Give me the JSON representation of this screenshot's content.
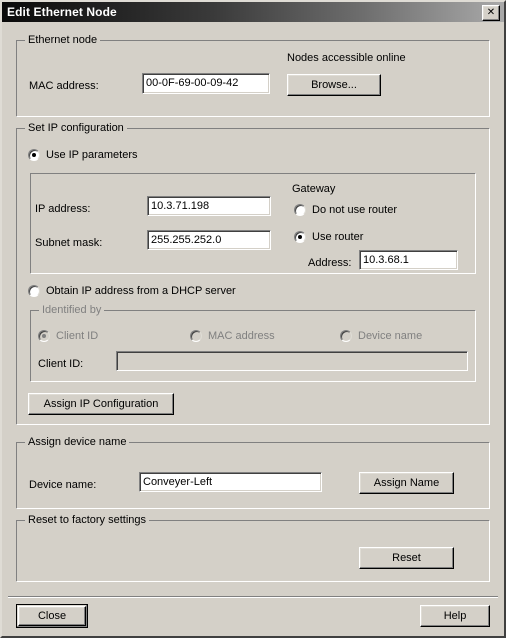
{
  "window": {
    "title": "Edit Ethernet Node",
    "close_icon": "close-icon",
    "close_glyph": "✕"
  },
  "ethernet_node": {
    "group_title": "Ethernet node",
    "nodes_online_label": "Nodes accessible online",
    "mac_label": "MAC address:",
    "mac_value": "00-0F-69-00-09-42",
    "mac_placeholder": "",
    "browse_button": "Browse..."
  },
  "ip_config": {
    "group_title": "Set IP configuration",
    "use_ip_parameters": {
      "label": "Use IP parameters",
      "checked": true
    },
    "ip_address_label": "IP address:",
    "ip_address_value": "10.3.71.198",
    "subnet_label": "Subnet mask:",
    "subnet_value": "255.255.252.0",
    "gateway": {
      "title": "Gateway",
      "do_not_use_router": {
        "label": "Do not use router",
        "checked": false
      },
      "use_router": {
        "label": "Use router",
        "checked": true
      },
      "address_label": "Address:",
      "address_value": "10.3.68.1"
    },
    "obtain_dhcp": {
      "label": "Obtain IP address from a DHCP server",
      "checked": false
    },
    "identified_by": {
      "group_title": "Identified by",
      "disabled": true,
      "options": [
        {
          "label": "Client ID",
          "checked": true
        },
        {
          "label": "MAC address",
          "checked": false
        },
        {
          "label": "Device name",
          "checked": false
        }
      ],
      "client_id_label": "Client ID:",
      "client_id_value": "",
      "client_id_disabled": true
    },
    "assign_ip_button": "Assign IP Configuration"
  },
  "assign_device_name": {
    "group_title": "Assign device name",
    "device_name_label": "Device name:",
    "device_name_value": "Conveyer-Left",
    "assign_name_button": "Assign Name"
  },
  "reset_factory": {
    "group_title": "Reset to factory settings",
    "reset_button": "Reset"
  },
  "footer": {
    "close_button": "Close",
    "help_button": "Help"
  },
  "colors": {
    "dialog_face": "#d4d0c8",
    "titlebar_dark": "#0a0a0a",
    "titlebar_light": "#a9a9a9",
    "field_bg": "#ffffff",
    "disabled_text": "#808080"
  }
}
